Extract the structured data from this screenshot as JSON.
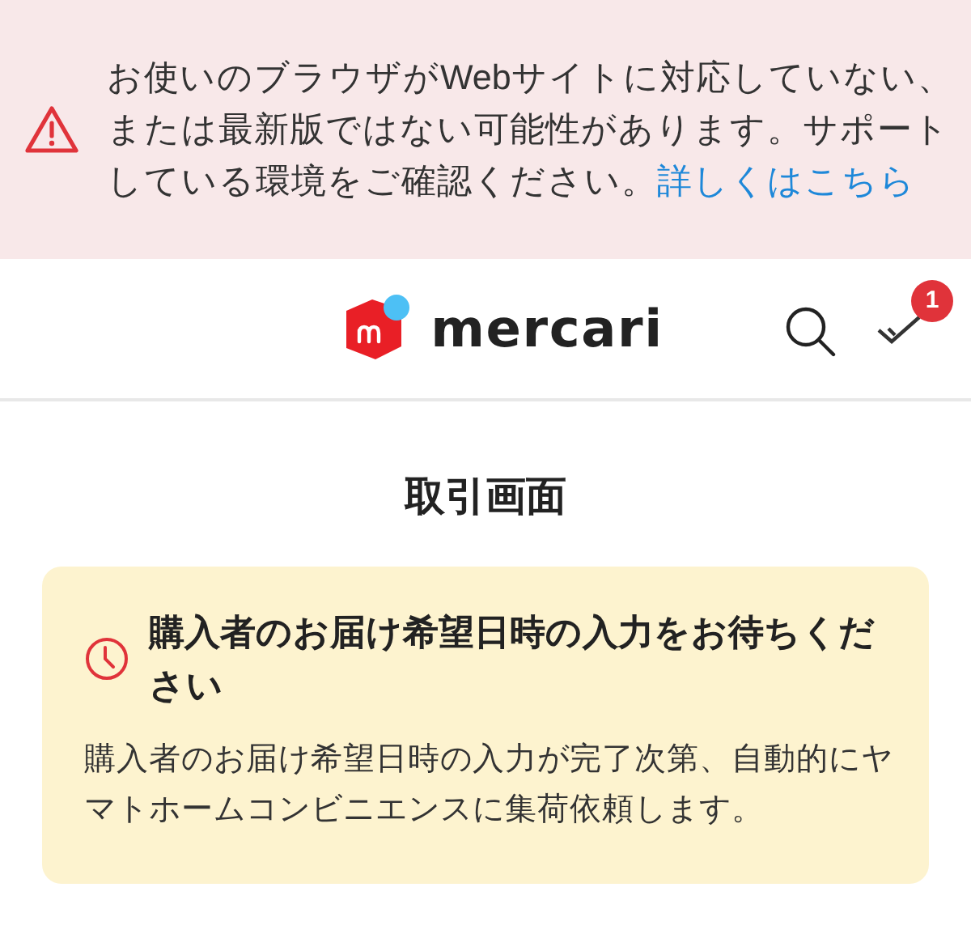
{
  "browser_warning": {
    "message": "お使いのブラウザがWebサイトに対応していない、または最新版ではない可能性があります。サポートしている環境をご確認ください。",
    "link": "詳しくはこちら"
  },
  "header": {
    "logo_text": "mercari",
    "notification_count": "1"
  },
  "page_title": "取引画面",
  "notice": {
    "title": "購入者のお届け希望日時の入力をお待ちください",
    "body": "購入者のお届け希望日時の入力が完了次第、自動的にヤマトホームコンビニエンスに集荷依頼します。"
  }
}
